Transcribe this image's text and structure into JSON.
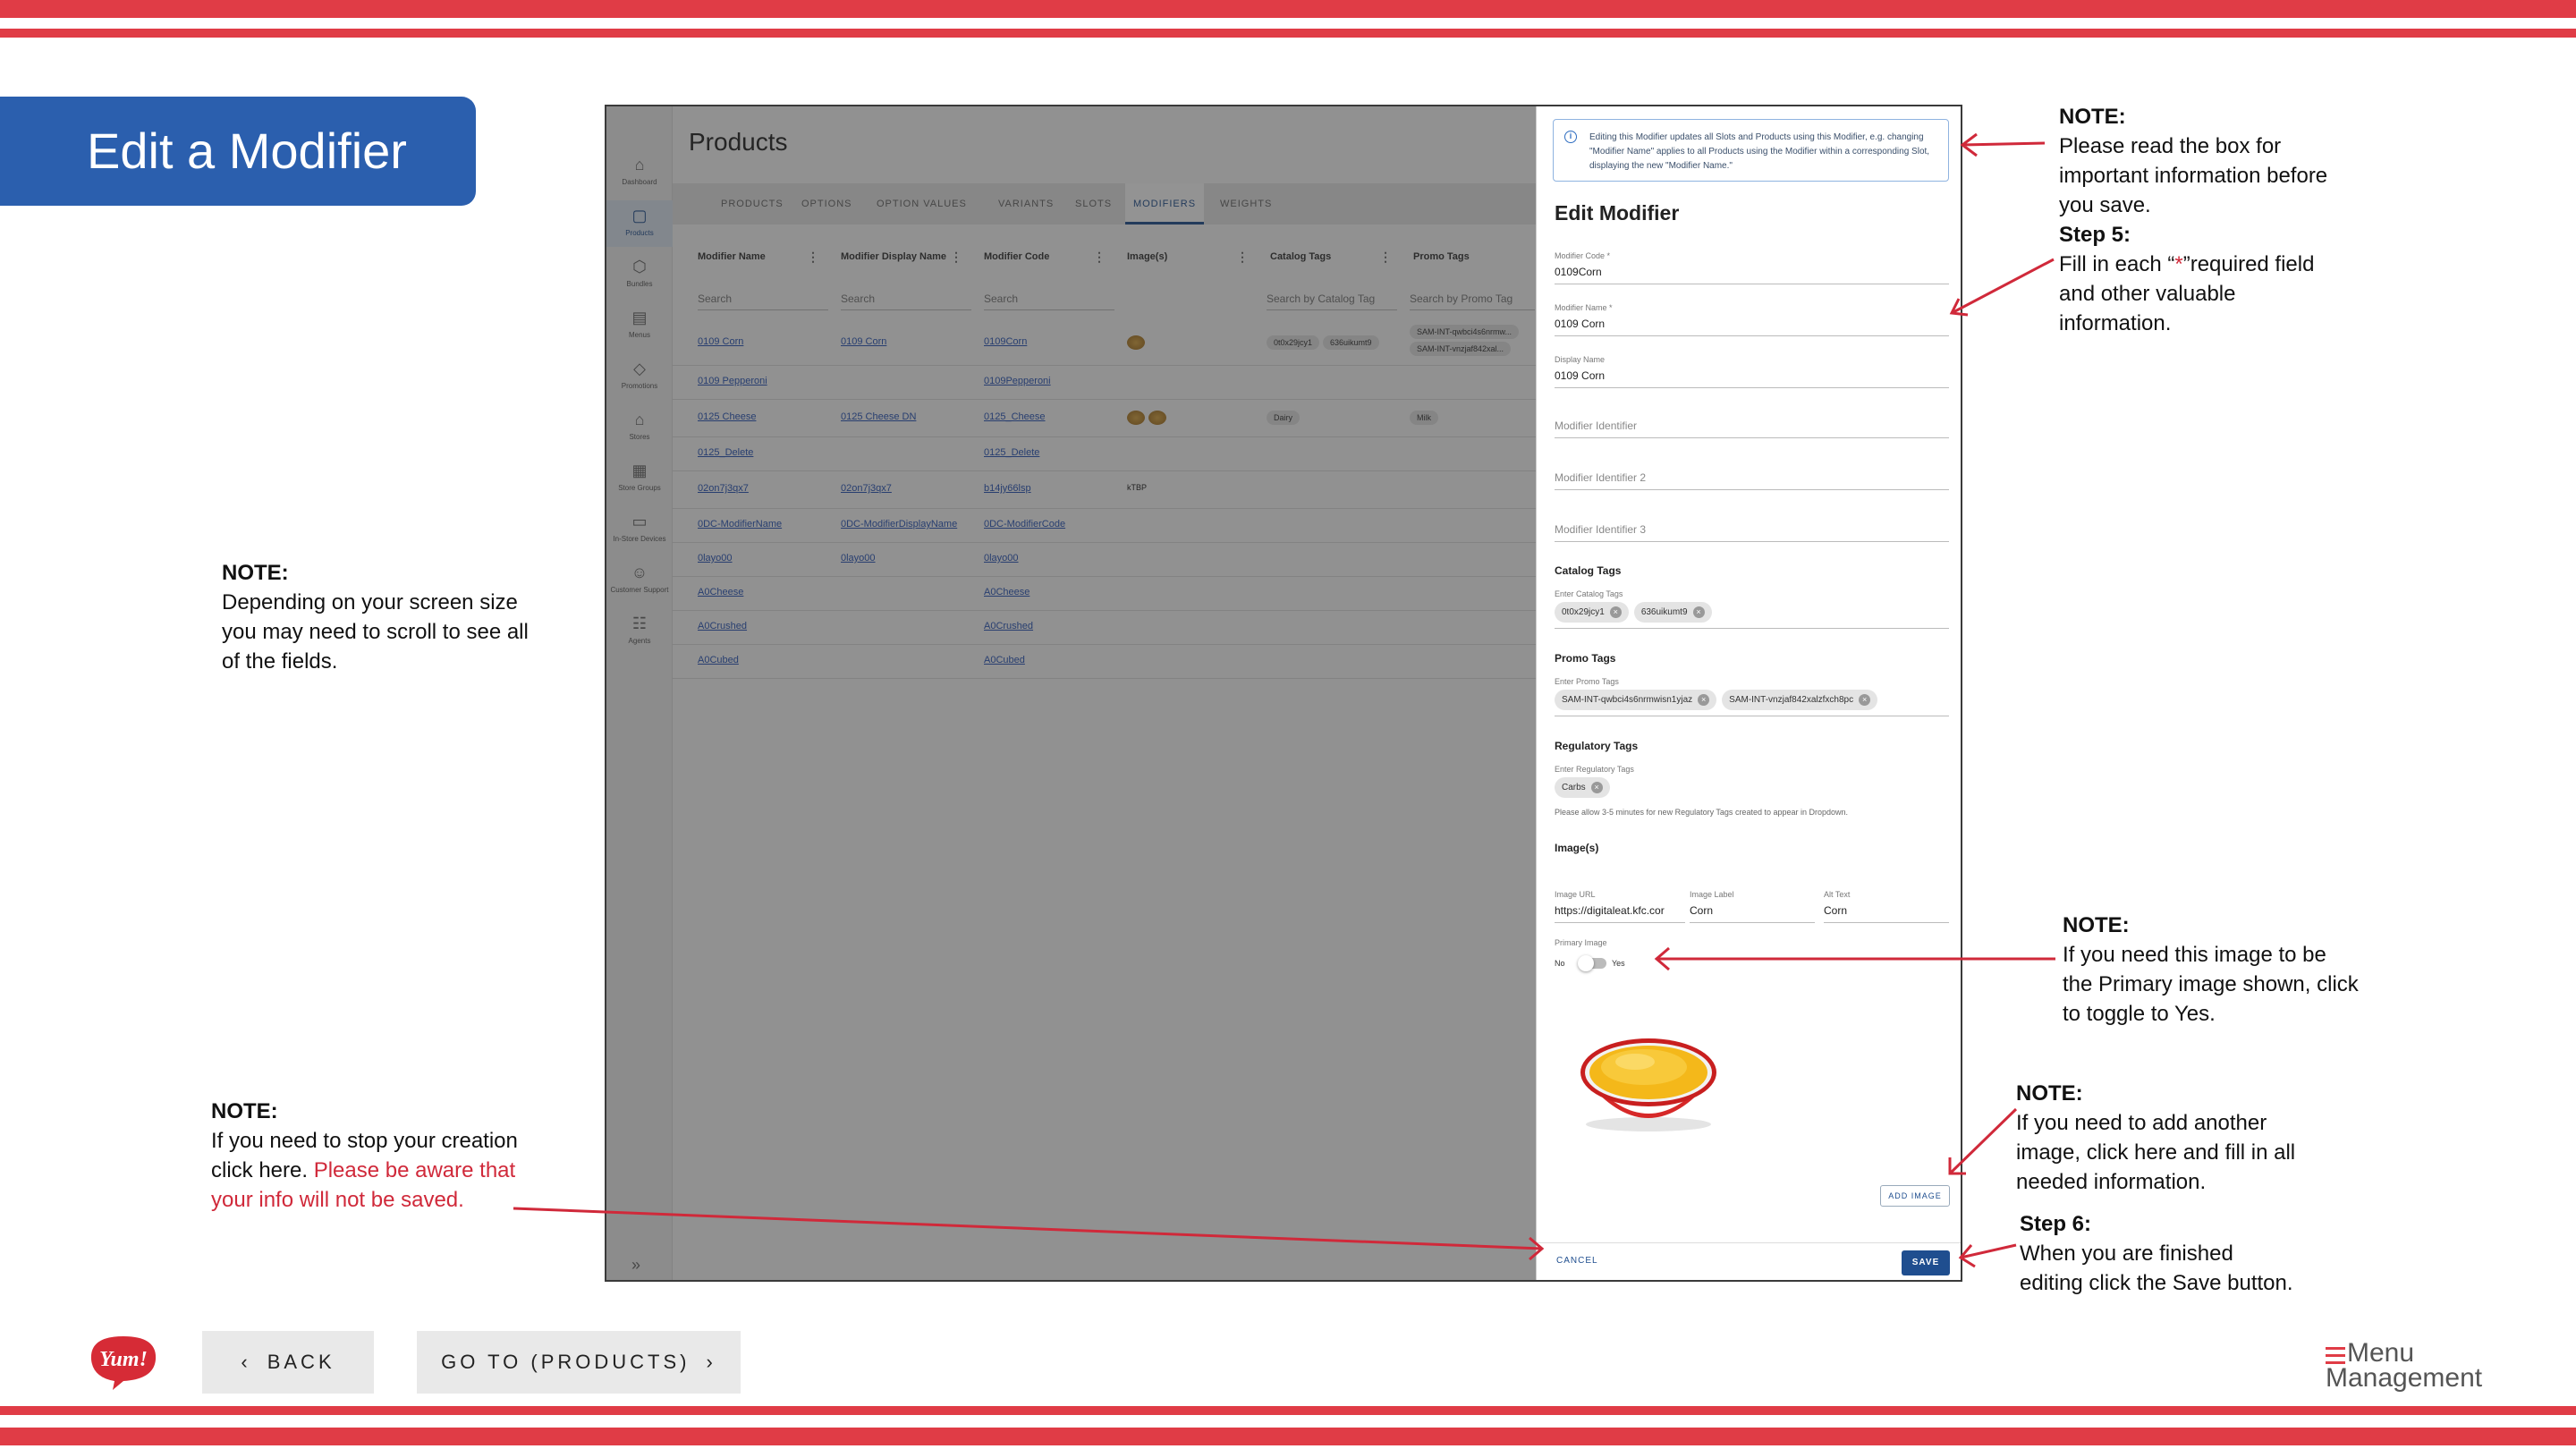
{
  "page": {
    "title": "Edit a Modifier"
  },
  "colors": {
    "brand_red": "#e03c46",
    "title_blue": "#2b5fae",
    "app_blue": "#1f4e8f",
    "link_blue": "#2855b8",
    "warning_red": "#d0293a"
  },
  "notes": {
    "scroll": {
      "heading": "NOTE:",
      "lines": [
        "Depending on your screen size",
        "you may need to scroll to see all",
        "of the fields."
      ]
    },
    "cancel": {
      "heading": "NOTE:",
      "line1": "If you need to stop your creation",
      "line2a": "click here. ",
      "line2b": "Please be aware that",
      "line3": "your info will not be saved."
    },
    "info_box": {
      "heading": "NOTE:",
      "lines": [
        "Please read the box for",
        "important information before",
        "you save."
      ]
    },
    "step5": {
      "heading": "Step 5:",
      "line1a": "Fill in each “",
      "star": "*",
      "line1b": "”required field",
      "lines": [
        "and other valuable",
        "information."
      ]
    },
    "primary": {
      "heading": "NOTE:",
      "lines": [
        "If you need this image to be",
        "the Primary image shown, click",
        "to toggle to Yes."
      ]
    },
    "add_image": {
      "heading": "NOTE:",
      "lines": [
        "If you need to add another",
        "image, click here and fill in all",
        "needed information."
      ]
    },
    "step6": {
      "heading": "Step 6:",
      "lines": [
        "When you are finished",
        "editing click the Save button."
      ]
    }
  },
  "app": {
    "title": "Products",
    "nav": [
      {
        "icon": "⌂",
        "icon_name": "home-icon",
        "label": "Dashboard"
      },
      {
        "icon": "▢",
        "icon_name": "box-icon",
        "label": "Products"
      },
      {
        "icon": "⬡",
        "icon_name": "cube-icon",
        "label": "Bundles"
      },
      {
        "icon": "▤",
        "icon_name": "document-icon",
        "label": "Menus"
      },
      {
        "icon": "◇",
        "icon_name": "tag-icon",
        "label": "Promotions"
      },
      {
        "icon": "⌂",
        "icon_name": "store-icon",
        "label": "Stores"
      },
      {
        "icon": "▦",
        "icon_name": "grid-icon",
        "label": "Store Groups"
      },
      {
        "icon": "▭",
        "icon_name": "monitor-icon",
        "label": "In-Store Devices"
      },
      {
        "icon": "☺",
        "icon_name": "support-icon",
        "label": "Customer Support"
      },
      {
        "icon": "☷",
        "icon_name": "agents-icon",
        "label": "Agents"
      }
    ],
    "tabs": [
      "PRODUCTS",
      "OPTIONS",
      "OPTION VALUES",
      "VARIANTS",
      "SLOTS",
      "MODIFIERS",
      "WEIGHTS"
    ],
    "active_tab": "MODIFIERS",
    "columns": [
      "Modifier Name",
      "Modifier Display Name",
      "Modifier Code",
      "Image(s)",
      "Catalog Tags",
      "Promo Tags"
    ],
    "search_placeholders": [
      "Search",
      "Search",
      "Search",
      "Search by Catalog Tag",
      "Search by Promo Tag"
    ],
    "rows": [
      {
        "name": "0109 Corn",
        "display": "0109 Corn",
        "code": "0109Corn",
        "images": 1,
        "catalog": [
          "0t0x29jcy1",
          "636uikumt9"
        ],
        "promo": [
          "SAM-INT-qwbci4s6nrmw...",
          "SAM-INT-vnzjaf842xal..."
        ]
      },
      {
        "name": "0109 Pepperoni",
        "display": "",
        "code": "0109Pepperoni",
        "images": 0,
        "catalog": [],
        "promo": []
      },
      {
        "name": "0125 Cheese",
        "display": "0125 Cheese DN",
        "code": "0125_Cheese",
        "images": 2,
        "catalog": [
          "Dairy"
        ],
        "promo": [
          "Milk"
        ]
      },
      {
        "name": "0125_Delete",
        "display": "",
        "code": "0125_Delete",
        "images": 0,
        "catalog": [],
        "promo": []
      },
      {
        "name": "02on7j3qx7",
        "display": "02on7j3qx7",
        "code": "b14jy66lsp",
        "images": 0,
        "image_alt": "kTBP",
        "catalog": [],
        "promo": []
      },
      {
        "name": "0DC-ModifierName",
        "display": "0DC-ModifierDisplayName",
        "code": "0DC-ModifierCode",
        "images": 0,
        "catalog": [],
        "promo": []
      },
      {
        "name": "0layo00",
        "display": "0layo00",
        "code": "0layo00",
        "images": 0,
        "catalog": [],
        "promo": []
      },
      {
        "name": "A0Cheese",
        "display": "",
        "code": "A0Cheese",
        "images": 0,
        "catalog": [],
        "promo": []
      },
      {
        "name": "A0Crushed",
        "display": "",
        "code": "A0Crushed",
        "images": 0,
        "catalog": [],
        "promo": []
      },
      {
        "name": "A0Cubed",
        "display": "",
        "code": "A0Cubed",
        "images": 0,
        "catalog": [],
        "promo": []
      }
    ]
  },
  "drawer": {
    "info": "Editing this Modifier updates all Slots and Products using this Modifier, e.g. changing \"Modifier Name\" applies to all Products using the Modifier within a corresponding Slot, displaying the new \"Modifier Name.\"",
    "title": "Edit Modifier",
    "modifier_code_label": "Modifier Code *",
    "modifier_code": "0109Corn",
    "modifier_name_label": "Modifier Name *",
    "modifier_name": "0109 Corn",
    "display_name_label": "Display Name",
    "display_name": "0109 Corn",
    "identifier_1": "Modifier Identifier",
    "identifier_2": "Modifier Identifier 2",
    "identifier_3": "Modifier Identifier 3",
    "catalog_section": "Catalog Tags",
    "catalog_hint": "Enter Catalog Tags",
    "catalog_tags": [
      "0t0x29jcy1",
      "636uikumt9"
    ],
    "promo_section": "Promo Tags",
    "promo_hint": "Enter Promo Tags",
    "promo_tags": [
      "SAM-INT-qwbci4s6nrmwisn1yjaz",
      "SAM-INT-vnzjaf842xalzfxch8pc"
    ],
    "reg_section": "Regulatory Tags",
    "reg_hint": "Enter Regulatory Tags",
    "reg_tags": [
      "Carbs"
    ],
    "reg_note": "Please allow 3-5 minutes for new Regulatory Tags created to appear in Dropdown.",
    "images_section": "Image(s)",
    "image_url_label": "Image URL",
    "image_url": "https://digitaleat.kfc.cor",
    "image_label_label": "Image Label",
    "image_label": "Corn",
    "alt_text_label": "Alt Text",
    "alt_text": "Corn",
    "primary_label": "Primary Image",
    "toggle_no": "No",
    "toggle_yes": "Yes",
    "primary_value": false,
    "add_image": "ADD IMAGE",
    "cancel": "CANCEL",
    "save": "SAVE"
  },
  "footer": {
    "back": "BACK",
    "goto": "GO TO (PRODUCTS)",
    "logo_left": "Yum!",
    "logo_right_1": "Menu",
    "logo_right_2": "Management"
  }
}
